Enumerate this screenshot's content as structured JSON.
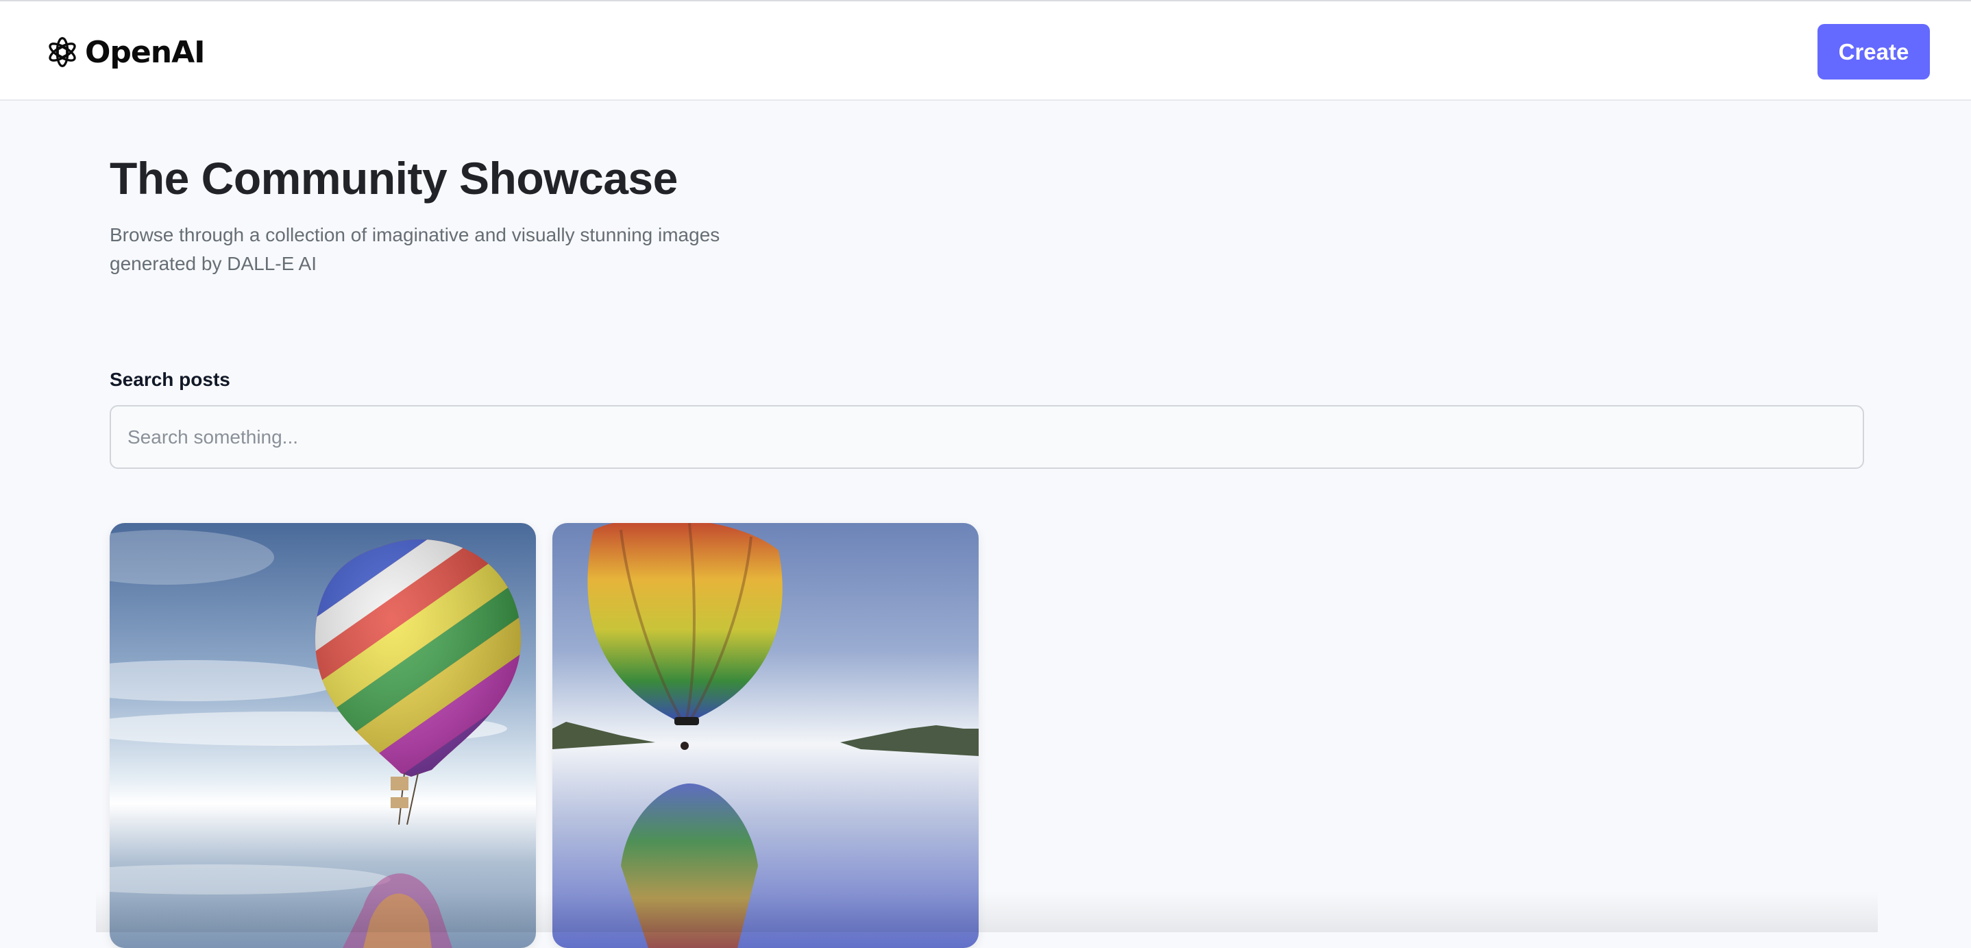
{
  "header": {
    "brand_name": "OpenAI",
    "logo_icon": "openai-knot-icon",
    "create_label": "Create",
    "accent_color": "#6469ff"
  },
  "hero": {
    "title": "The Community Showcase",
    "subtitle": "Browse through a collection of imaginative and visually stunning images generated by DALL-E AI"
  },
  "search": {
    "label": "Search posts",
    "placeholder": "Search something...",
    "value": ""
  },
  "posts": [
    {
      "image": "rainbow-hot-air-balloon-over-water"
    },
    {
      "image": "hot-air-balloon-reflected-on-lake"
    }
  ]
}
